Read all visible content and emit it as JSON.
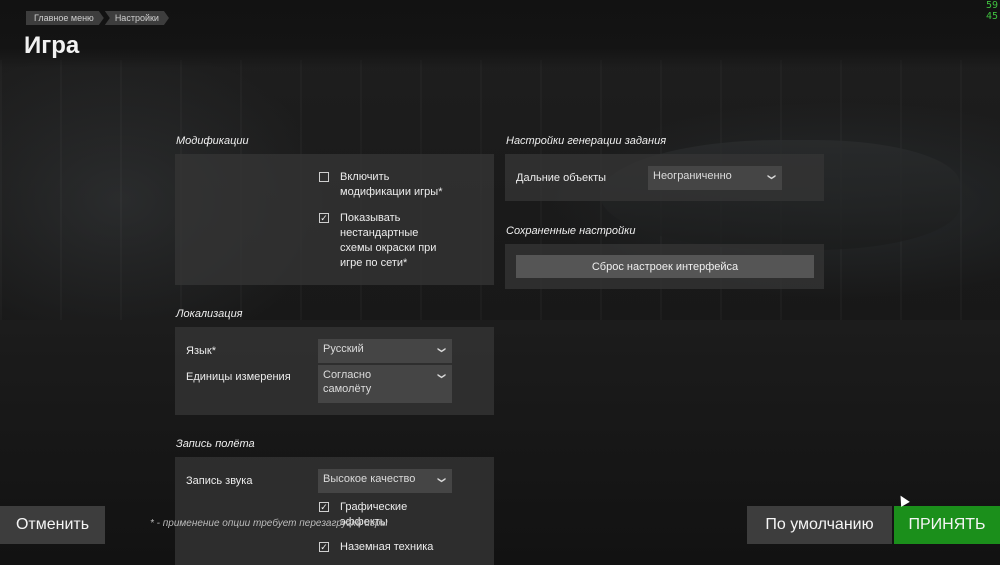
{
  "breadcrumb": [
    "Главное меню",
    "Настройки"
  ],
  "page": {
    "title": "Игра"
  },
  "fps": [
    "59",
    "45"
  ],
  "sections": {
    "mods": {
      "title": "Модификации",
      "checkboxes": [
        {
          "label_lines": [
            "Включить",
            "модификации игры*"
          ],
          "checked": false
        },
        {
          "label_lines": [
            "Показывать",
            "нестандартные",
            "схемы окраски при",
            "игре по сети*"
          ],
          "checked": true
        }
      ]
    },
    "localization": {
      "title": "Локализация",
      "language": {
        "label": "Язык*",
        "value": "Русский"
      },
      "units": {
        "label": "Единицы измерения",
        "value_lines": [
          "Согласно",
          "самолёту"
        ]
      }
    },
    "flight_record": {
      "title": "Запись полёта",
      "sound": {
        "label": "Запись звука",
        "value": "Высокое качество"
      },
      "checkboxes": [
        {
          "label_lines": [
            "Графические",
            "эффекты"
          ],
          "checked": true
        },
        {
          "label_lines": [
            "Наземная техника"
          ],
          "checked": true
        }
      ]
    },
    "mission_gen": {
      "title": "Настройки генерации задания",
      "far_objects": {
        "label": "Дальние объекты",
        "value": "Неограниченно"
      }
    },
    "saved": {
      "title": "Сохраненные настройки",
      "reset_label": "Сброс настроек интерфейса"
    }
  },
  "footnote": "* - применение опции требует перезагрузки игры",
  "buttons": {
    "cancel": "Отменить",
    "default": "По умолчанию",
    "accept": "ПРИНЯТЬ"
  },
  "icons": {
    "check": "✓",
    "chevron": "❯"
  },
  "colors": {
    "accent": "#1b8f1b",
    "panel": "#343434",
    "fps": "#3fbf3f"
  }
}
